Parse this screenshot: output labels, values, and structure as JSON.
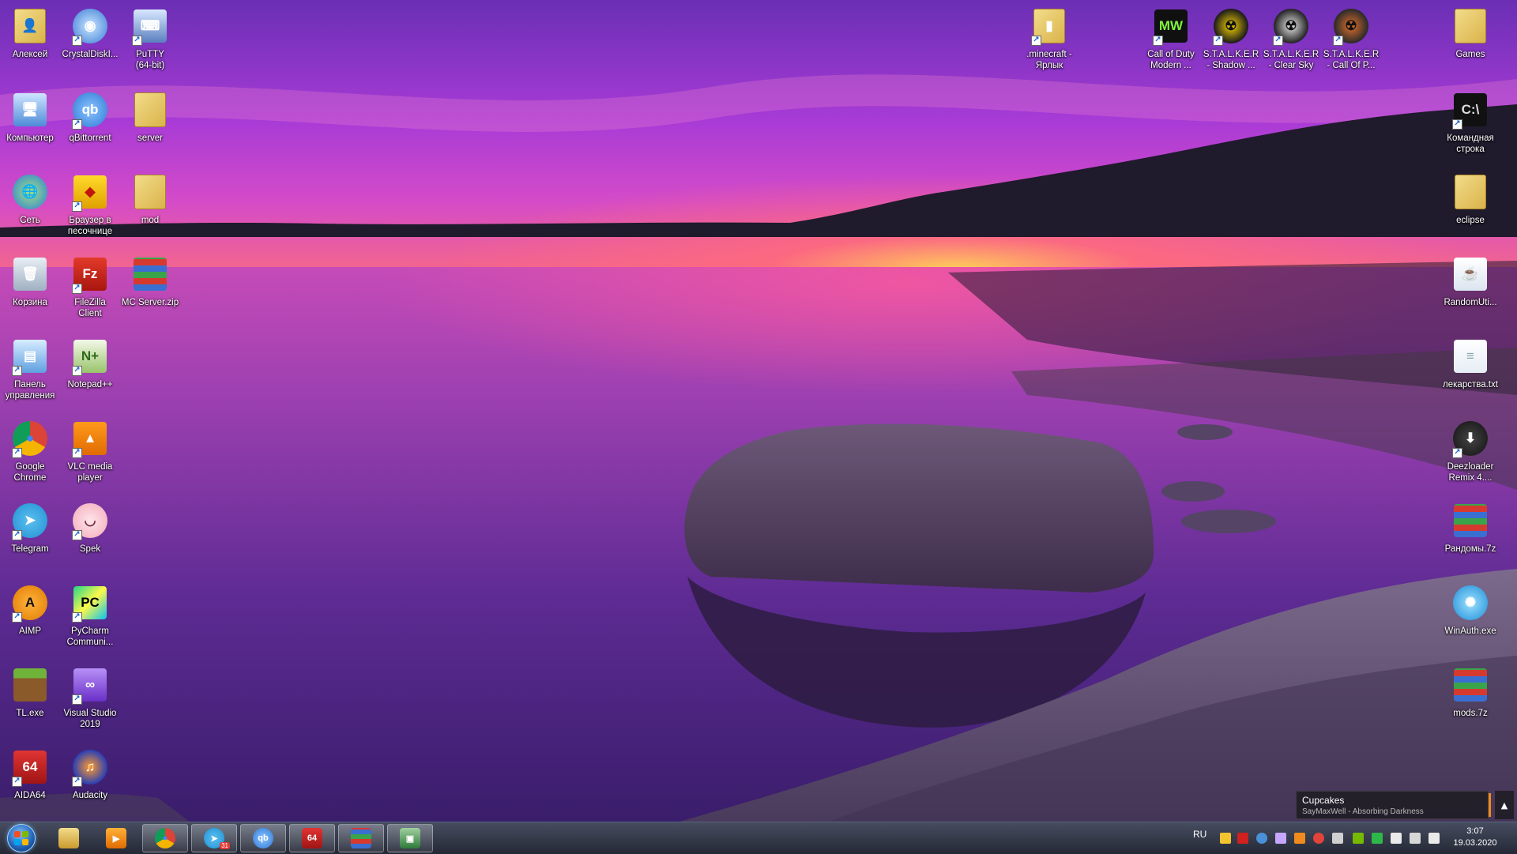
{
  "desktop": {
    "icons": [
      {
        "label": "Алексей",
        "icon": "user-folder-icon",
        "shortcut": false
      },
      {
        "label": "CrystalDiskI...",
        "icon": "crystaldisk-icon",
        "shortcut": true
      },
      {
        "label": "PuTTY\n(64-bit)",
        "icon": "putty-icon",
        "shortcut": true
      },
      {
        "label": "Компьютер",
        "icon": "computer-icon",
        "shortcut": false
      },
      {
        "label": "qBittorrent",
        "icon": "qbittorrent-icon",
        "shortcut": true
      },
      {
        "label": "server",
        "icon": "folder-icon",
        "shortcut": false
      },
      {
        "label": "Сеть",
        "icon": "network-icon",
        "shortcut": false
      },
      {
        "label": "Браузер в\nпесочнице",
        "icon": "sandbox-browser-icon",
        "shortcut": true
      },
      {
        "label": "mod",
        "icon": "folder-icon",
        "shortcut": false
      },
      {
        "label": "Корзина",
        "icon": "recycle-bin-icon",
        "shortcut": false
      },
      {
        "label": "FileZilla\nClient",
        "icon": "filezilla-icon",
        "shortcut": true
      },
      {
        "label": "MC Server.zip",
        "icon": "winrar-archive-icon",
        "shortcut": false
      },
      {
        "label": "Панель\nуправления",
        "icon": "control-panel-icon",
        "shortcut": true
      },
      {
        "label": "Notepad++",
        "icon": "notepadpp-icon",
        "shortcut": true
      },
      {
        "label": "Google\nChrome",
        "icon": "chrome-icon",
        "shortcut": true
      },
      {
        "label": "VLC media\nplayer",
        "icon": "vlc-icon",
        "shortcut": true
      },
      {
        "label": "Telegram",
        "icon": "telegram-icon",
        "shortcut": true
      },
      {
        "label": "Spek",
        "icon": "spek-icon",
        "shortcut": true
      },
      {
        "label": "AIMP",
        "icon": "aimp-icon",
        "shortcut": true
      },
      {
        "label": "PyCharm\nCommuni...",
        "icon": "pycharm-icon",
        "shortcut": true
      },
      {
        "label": "TL.exe",
        "icon": "minecraft-block-icon",
        "shortcut": false
      },
      {
        "label": "Visual Studio\n2019",
        "icon": "visual-studio-icon",
        "shortcut": true
      },
      {
        "label": "AIDA64",
        "icon": "aida64-icon",
        "shortcut": true
      },
      {
        "label": "Audacity",
        "icon": "audacity-icon",
        "shortcut": true
      },
      {
        "label": ".minecraft -\nЯрлык",
        "icon": "folder-shortcut-icon",
        "shortcut": true
      },
      {
        "label": "Call of Duty\nModern ...",
        "icon": "cod-mw-icon",
        "shortcut": true
      },
      {
        "label": "S.T.A.L.K.E.R\n- Shadow ...",
        "icon": "stalker-soc-icon",
        "shortcut": true
      },
      {
        "label": "S.T.A.L.K.E.R\n- Clear Sky",
        "icon": "stalker-cs-icon",
        "shortcut": true
      },
      {
        "label": "S.T.A.L.K.E.R\n- Call Of P...",
        "icon": "stalker-cop-icon",
        "shortcut": true
      },
      {
        "label": "Games",
        "icon": "folder-icon",
        "shortcut": false
      },
      {
        "label": "Командная\nстрока",
        "icon": "cmd-icon",
        "shortcut": true
      },
      {
        "label": "eclipse",
        "icon": "folder-icon",
        "shortcut": false
      },
      {
        "label": "RandomUti...",
        "icon": "jar-file-icon",
        "shortcut": false
      },
      {
        "label": "лекарства.txt",
        "icon": "text-file-icon",
        "shortcut": false
      },
      {
        "label": "Deezloader\nRemix 4....",
        "icon": "deezloader-icon",
        "shortcut": true
      },
      {
        "label": "Рандомы.7z",
        "icon": "winrar-archive-icon",
        "shortcut": false
      },
      {
        "label": "WinAuth.exe",
        "icon": "winauth-icon",
        "shortcut": false
      },
      {
        "label": "mods.7z",
        "icon": "winrar-archive-icon",
        "shortcut": false
      }
    ]
  },
  "taskbar": {
    "start_icon": "windows-orb-icon",
    "pinned": [
      {
        "name": "explorer",
        "icon": "explorer-folder-icon",
        "active": false
      },
      {
        "name": "media-player",
        "icon": "media-player-icon",
        "active": false
      },
      {
        "name": "chrome",
        "icon": "chrome-icon",
        "active": true
      },
      {
        "name": "telegram",
        "icon": "telegram-icon",
        "active": true,
        "badge": "31"
      },
      {
        "name": "qbittorrent",
        "icon": "qbittorrent-icon",
        "active": true
      },
      {
        "name": "aida64",
        "icon": "aida64-icon",
        "active": true
      },
      {
        "name": "winrar",
        "icon": "winrar-icon",
        "active": true
      },
      {
        "name": "task-manager",
        "icon": "monitor-icon",
        "active": true
      }
    ],
    "tray": {
      "language": "RU",
      "icons": [
        "shield-icon",
        "aida64-tray-icon",
        "network-globe-icon",
        "pen-icon",
        "aimp-tray-icon",
        "red-circle-icon",
        "speaker-icon",
        "nvidia-icon",
        "green-square-icon",
        "flag-icon",
        "monitor-tray-icon",
        "volume-icon"
      ],
      "time": "3:07",
      "date": "19.03.2020"
    }
  },
  "now_playing": {
    "title": "Cupcakes",
    "artist": "SayMaxWell - Absorbing Darkness",
    "expand_glyph": "▲"
  }
}
